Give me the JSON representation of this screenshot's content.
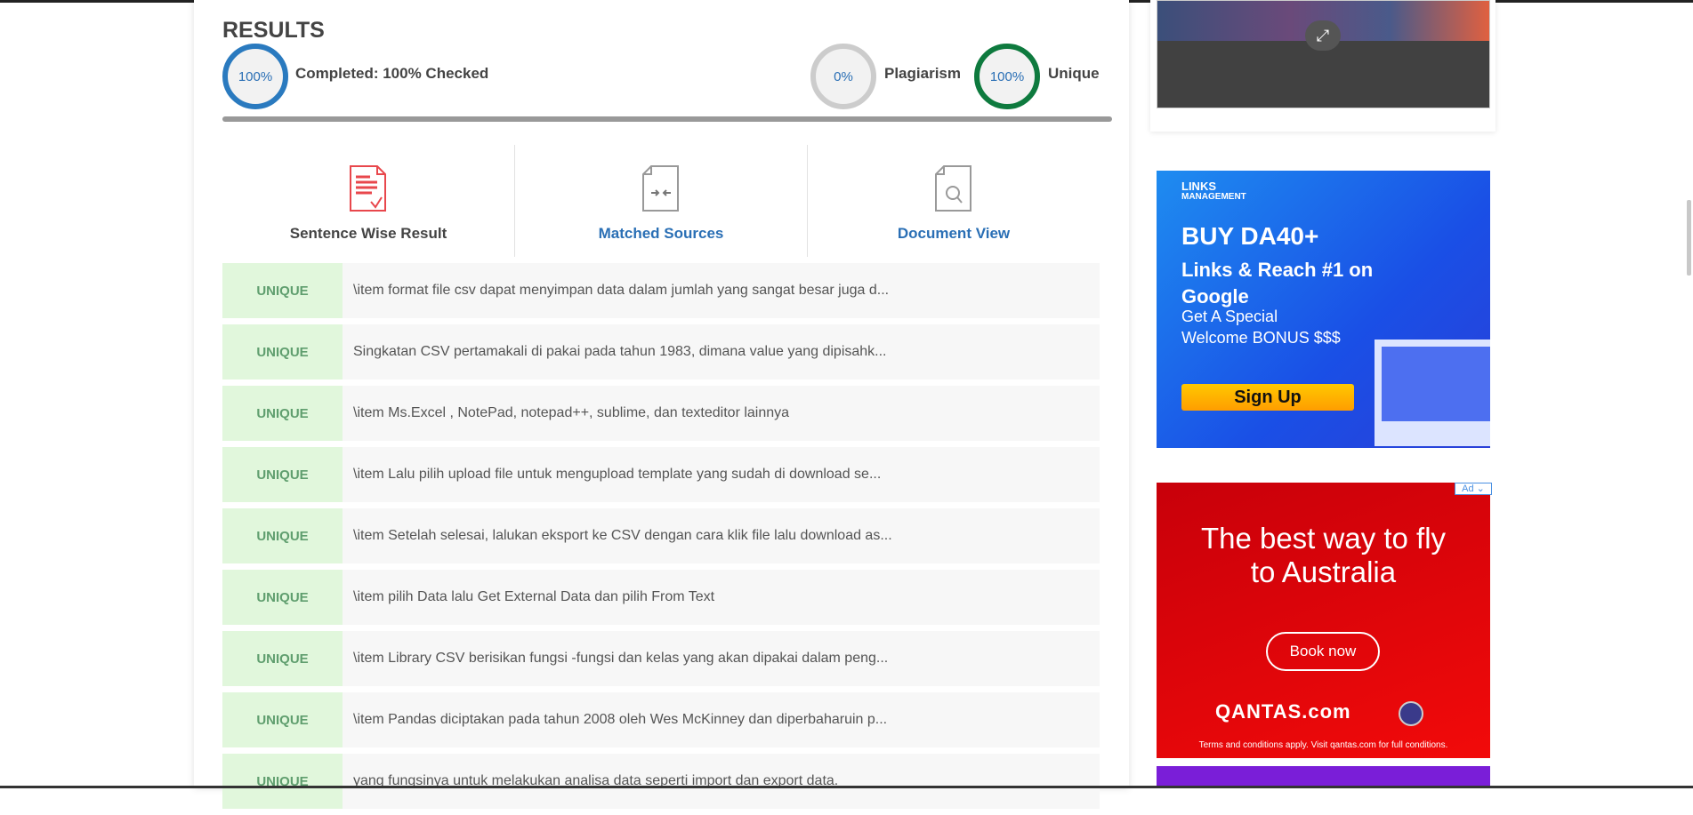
{
  "results": {
    "title": "RESULTS",
    "completed_percent": "100%",
    "completed_label": "Completed: 100% Checked",
    "plagiarism_percent": "0%",
    "plagiarism_label": "Plagiarism",
    "unique_percent": "100%",
    "unique_label": "Unique",
    "progress": 100
  },
  "tabs": [
    {
      "label": "Sentence Wise Result"
    },
    {
      "label": "Matched Sources"
    },
    {
      "label": "Document View"
    }
  ],
  "rows": [
    {
      "status": "UNIQUE",
      "text": "\\item format file csv dapat menyimpan data dalam jumlah yang sangat besar juga d..."
    },
    {
      "status": "UNIQUE",
      "text": "Singkatan CSV pertamakali di pakai pada tahun 1983, dimana value yang dipisahk..."
    },
    {
      "status": "UNIQUE",
      "text": "\\item Ms.Excel , NotePad, notepad++, sublime, dan texteditor lainnya"
    },
    {
      "status": "UNIQUE",
      "text": "\\item Lalu pilih upload file untuk mengupload template yang sudah di download se..."
    },
    {
      "status": "UNIQUE",
      "text": "\\item Setelah selesai, lalukan eksport ke CSV dengan cara klik file lalu download as..."
    },
    {
      "status": "UNIQUE",
      "text": "\\item pilih Data lalu Get External Data dan pilih From Text"
    },
    {
      "status": "UNIQUE",
      "text": "\\item Library CSV berisikan fungsi -fungsi dan kelas yang akan dipakai dalam peng..."
    },
    {
      "status": "UNIQUE",
      "text": "\\item Pandas diciptakan pada tahun 2008 oleh Wes McKinney dan diperbaharuin p..."
    },
    {
      "status": "UNIQUE",
      "text": "yang fungsinya untuk melakukan analisa data seperti import dan export data."
    }
  ],
  "ads": {
    "links": {
      "brand1": "LINKS",
      "brand2": "MANAGEMENT",
      "headline": "BUY DA40+",
      "sub": "Links & Reach #1 on Google",
      "offer1": "Get A Special",
      "offer2": "Welcome BONUS $$$",
      "button": "Sign Up"
    },
    "qantas": {
      "tag": "Ad ⌄",
      "headline1": "The best way to fly",
      "headline2": "to Australia",
      "button": "Book now",
      "logo": "QANTAS.com",
      "terms": "Terms and conditions apply. Visit qantas.com for full conditions."
    }
  },
  "colors": {
    "blue": "#2a7abf",
    "green": "#0e7a3e",
    "gray": "#cccccc",
    "link": "#2a6fb5",
    "red_icon": "#e8474c"
  }
}
